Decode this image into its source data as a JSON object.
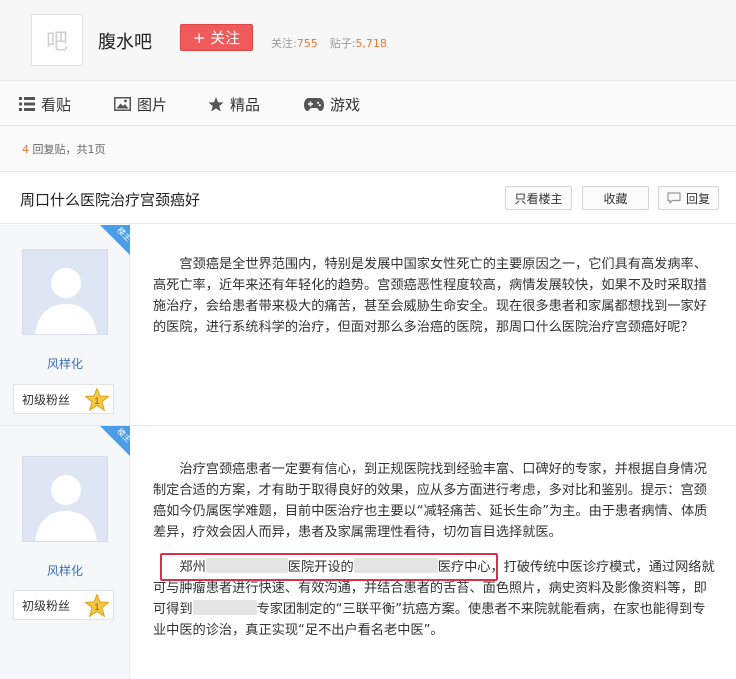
{
  "header": {
    "logo_char": "吧",
    "forum_name": "腹水吧",
    "follow_label": "+ 关注",
    "followers_label": "关注:",
    "followers_value": "755",
    "posts_label": "贴子:",
    "posts_value": "5,718"
  },
  "nav": {
    "items": [
      {
        "label": "看贴",
        "icon": "list-icon"
      },
      {
        "label": "图片",
        "icon": "image-icon"
      },
      {
        "label": "精品",
        "icon": "star-icon"
      },
      {
        "label": "游戏",
        "icon": "gamepad-icon"
      }
    ]
  },
  "reply_info": {
    "count": "4",
    "text": "回复贴，共1页"
  },
  "thread": {
    "title": "周口什么医院治疗宫颈癌好",
    "only_op_label": "只看楼主",
    "favorite_label": "收藏",
    "reply_label": "回复"
  },
  "posts": [
    {
      "author": "风样化",
      "level": "初级粉丝",
      "level_num": "1",
      "badge": "楼主",
      "text": "宫颈癌是全世界范围内，特别是发展中国家女性死亡的主要原因之一，它们具有高发病率、高死亡率，近年来还有年轻化的趋势。宫颈癌恶性程度较高，病情发展较快，如果不及时采取措施治疗，会给患者带来极大的痛苦，甚至会威胁生命安全。现在很多患者和家属都想找到一家好的医院，进行系统科学的治疗，但面对那么多治癌的医院，那周口什么医院治疗宫颈癌好呢？"
    },
    {
      "author": "风样化",
      "level": "初级粉丝",
      "level_num": "1",
      "badge": "楼主",
      "text_a": "治疗宫颈癌患者一定要有信心，到正规医院找到经验丰富、口碑好的专家，并根据自身情况制定合适的方案，才有助于取得良好的效果，应从多方面进行考虑，多对比和鉴别。提示：宫颈癌如今仍属医学难题，目前中医治疗也主要以“减轻痛苦、延长生命”为主。由于患者病情、体质差异，疗效会因人而异，患者及家属需理性看待，切勿盲目选择就医。",
      "text_b1": "郑州",
      "text_b2": "医院开设的",
      "text_b3": "医疗中心，打破传统中医诊疗模式，通过网络就可与肿瘤患者进行快速、有效沟通，并结合患者的舌苔、面色照片，病史资料及影像资料等，即可得到",
      "text_b4": "专家团制定的“三联平衡”抗癌方案。使患者不来院就能看病，在家也能得到专业中医的诊治，真正实现“足不出户看名老中医”。"
    }
  ],
  "colors": {
    "accent": "#ef5a5a",
    "count_highlight": "#e5793a",
    "author_link": "#3a6fb5",
    "badge_blue": "#4a9de6",
    "highlight_box": "#d9304c"
  }
}
